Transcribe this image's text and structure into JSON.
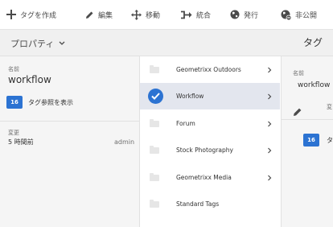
{
  "toolbar": {
    "create_tag": "タグを作成",
    "edit": "編集",
    "move": "移動",
    "merge": "統合",
    "publish": "発行",
    "unpublish": "非公開"
  },
  "header": {
    "properties_label": "プロパティ",
    "panel_title": "タグ"
  },
  "properties": {
    "name_label": "名前",
    "name_value": "workflow",
    "references_count": "16",
    "references_link": "タグ参照を表示",
    "modified_label": "変更",
    "modified_time": "5 時間前",
    "modified_by": "admin"
  },
  "tags": [
    {
      "label": "Geometrixx Outdoors",
      "selected": false
    },
    {
      "label": "Workflow",
      "selected": true
    },
    {
      "label": "Forum",
      "selected": false
    },
    {
      "label": "Stock Photography",
      "selected": false
    },
    {
      "label": "Geometrixx Media",
      "selected": false
    },
    {
      "label": "Standard Tags",
      "selected": false
    }
  ],
  "preview": {
    "name_label": "名前",
    "name_value": "workflow",
    "change_label": "変",
    "references_count": "16",
    "references_text": "タ"
  },
  "colors": {
    "accent": "#2c73d2",
    "selected_row": "#e3e6ee",
    "panel_bg": "#f5f5f5"
  }
}
